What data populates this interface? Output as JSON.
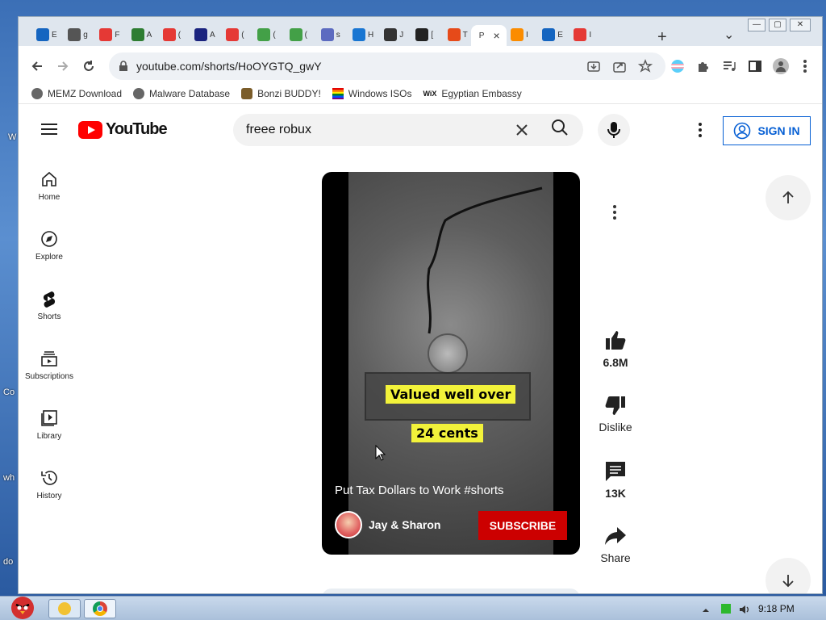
{
  "browser": {
    "tabs": [
      {
        "label": "E",
        "color": "#1565c0"
      },
      {
        "label": "g",
        "color": "#555555"
      },
      {
        "label": "F",
        "color": "#e53935"
      },
      {
        "label": "A",
        "color": "#2e7d32"
      },
      {
        "label": "(",
        "color": "#e53935"
      },
      {
        "label": "A",
        "color": "#1a237e"
      },
      {
        "label": "(",
        "color": "#e53935"
      },
      {
        "label": "(",
        "color": "#43a047"
      },
      {
        "label": "(",
        "color": "#43a047"
      },
      {
        "label": "s",
        "color": "#5c6bc0"
      },
      {
        "label": "H",
        "color": "#1976d2"
      },
      {
        "label": "J",
        "color": "#333333"
      },
      {
        "label": "[",
        "color": "#222222"
      },
      {
        "label": "T",
        "color": "#e64a19"
      },
      {
        "label": "P",
        "color": "#ffffff"
      },
      {
        "label": "I",
        "color": "#fb8c00"
      },
      {
        "label": "E",
        "color": "#1565c0"
      },
      {
        "label": "I",
        "color": "#e53935"
      }
    ],
    "active_tab_close": "×",
    "new_tab": "+",
    "tab_menu": "⌄",
    "url": "youtube.com/shorts/HoOYGTQ_gwY",
    "bookmarks": [
      {
        "label": "MEMZ Download",
        "icon": "globe-icon"
      },
      {
        "label": "Malware Database",
        "icon": "globe-icon"
      },
      {
        "label": "Bonzi BUDDY!",
        "icon": "bonzi-icon"
      },
      {
        "label": "Windows ISOs",
        "icon": "rainbow-icon"
      },
      {
        "label": "Egyptian Embassy",
        "icon": "wix-icon"
      }
    ],
    "wix_text": "WiX"
  },
  "youtube": {
    "logo_text": "YouTube",
    "search_value": "freee robux",
    "signin_label": "SIGN IN",
    "sidebar": [
      {
        "label": "Home",
        "icon": "home-icon"
      },
      {
        "label": "Explore",
        "icon": "compass-icon"
      },
      {
        "label": "Shorts",
        "icon": "shorts-icon"
      },
      {
        "label": "Subscriptions",
        "icon": "subscriptions-icon"
      },
      {
        "label": "Library",
        "icon": "library-icon"
      },
      {
        "label": "History",
        "icon": "history-icon"
      }
    ],
    "short": {
      "caption_1": "Valued well over",
      "caption_2": "24 cents",
      "title": "Put Tax Dollars to Work #shorts",
      "channel": "Jay & Sharon",
      "subscribe_label": "SUBSCRIBE"
    },
    "actions": {
      "like_count": "6.8M",
      "dislike_label": "Dislike",
      "comments_count": "13K",
      "share_label": "Share"
    }
  },
  "taskbar": {
    "clock": "9:18 PM"
  },
  "desktop": {
    "fragments": [
      "W",
      "Co",
      "wh",
      "do"
    ]
  },
  "colors": {
    "yt_red": "#ff0000",
    "signin_blue": "#065fd4",
    "subscribe_red": "#cc0000",
    "caption_yellow": "#f2f23a"
  }
}
